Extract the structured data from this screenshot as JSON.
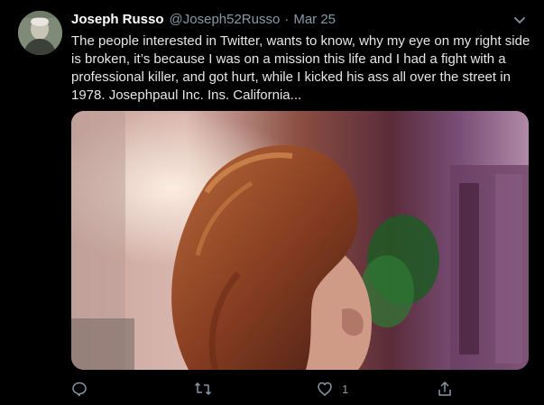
{
  "tweet": {
    "display_name": "Joseph Russo",
    "handle": "@Joseph52Russo",
    "separator": "·",
    "time": "Mar 25",
    "text": "The people interested in Twitter, wants to know, why my eye on my right side is broken, it’s because I was on a mission this life and I had a fight with a professional killer, and got hurt, while I kicked his ass all over the street in 1978. Josephpaul Inc. Ins. California...",
    "like_count": "1"
  },
  "icons": {
    "more": "chevron-down-icon",
    "reply": "reply-icon",
    "retweet": "retweet-icon",
    "like": "heart-icon",
    "share": "share-icon"
  },
  "colors": {
    "background": "#000000",
    "primary_text": "#ffffff",
    "secondary_text": "#8899a6"
  }
}
